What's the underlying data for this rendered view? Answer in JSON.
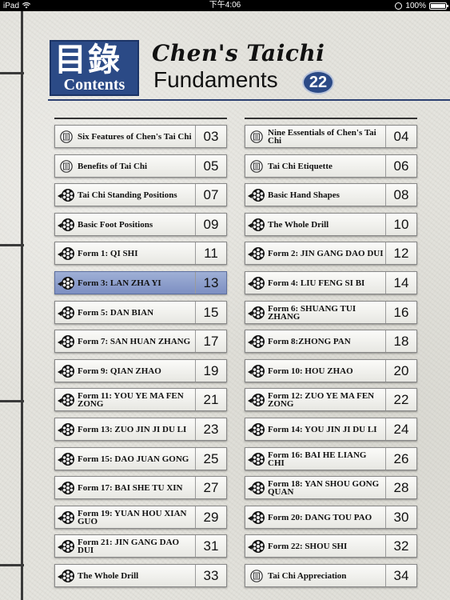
{
  "status_bar": {
    "device": "iPad",
    "time": "下午4:06",
    "battery": "100%"
  },
  "header": {
    "logo_chars": "目錄",
    "logo_en": "Contents",
    "title_line1": "Chen's Taichi",
    "title_line2": "Fundaments",
    "badge": "22"
  },
  "colors": {
    "accent": "#2b4a86",
    "selected": "#8a9bcb"
  },
  "left_items": [
    {
      "label": "Six Features of Chen's Tai Chi",
      "page": "03",
      "icon": "document-icon"
    },
    {
      "label": "Benefits of Tai Chi",
      "page": "05",
      "icon": "document-icon"
    },
    {
      "label": "Tai Chi Standing Positions",
      "page": "07",
      "icon": "film-reel-icon"
    },
    {
      "label": "Basic Foot Positions",
      "page": "09",
      "icon": "film-reel-icon"
    },
    {
      "label": "Form 1: QI SHI",
      "page": "11",
      "icon": "film-reel-icon"
    },
    {
      "label": "Form 3: LAN ZHA YI",
      "page": "13",
      "icon": "film-reel-icon",
      "selected": true
    },
    {
      "label": "Form 5: DAN BIAN",
      "page": "15",
      "icon": "film-reel-icon"
    },
    {
      "label": "Form 7: SAN HUAN ZHANG",
      "page": "17",
      "icon": "film-reel-icon"
    },
    {
      "label": "Form 9: QIAN ZHAO",
      "page": "19",
      "icon": "film-reel-icon"
    },
    {
      "label": "Form 11: YOU YE MA FEN ZONG",
      "page": "21",
      "icon": "film-reel-icon"
    },
    {
      "label": "Form 13: ZUO JIN JI DU LI",
      "page": "23",
      "icon": "film-reel-icon"
    },
    {
      "label": "Form 15: DAO JUAN GONG",
      "page": "25",
      "icon": "film-reel-icon"
    },
    {
      "label": "Form 17: BAI SHE TU XIN",
      "page": "27",
      "icon": "film-reel-icon"
    },
    {
      "label": "Form 19: YUAN HOU XIAN GUO",
      "page": "29",
      "icon": "film-reel-icon"
    },
    {
      "label": "Form 21: JIN GANG DAO DUI",
      "page": "31",
      "icon": "film-reel-icon"
    },
    {
      "label": "The Whole Drill",
      "page": "33",
      "icon": "film-reel-icon"
    }
  ],
  "right_items": [
    {
      "label": "Nine Essentials of Chen's Tai Chi",
      "page": "04",
      "icon": "document-icon"
    },
    {
      "label": "Tai Chi Etiquette",
      "page": "06",
      "icon": "document-icon"
    },
    {
      "label": "Basic Hand Shapes",
      "page": "08",
      "icon": "film-reel-icon"
    },
    {
      "label": "The Whole Drill",
      "page": "10",
      "icon": "film-reel-icon"
    },
    {
      "label": "Form 2: JIN GANG DAO DUI",
      "page": "12",
      "icon": "film-reel-icon"
    },
    {
      "label": "Form 4:  LIU FENG SI BI",
      "page": "14",
      "icon": "film-reel-icon"
    },
    {
      "label": "Form 6: SHUANG TUI ZHANG",
      "page": "16",
      "icon": "film-reel-icon"
    },
    {
      "label": "Form 8:ZHONG PAN",
      "page": "18",
      "icon": "film-reel-icon"
    },
    {
      "label": "Form 10: HOU ZHAO",
      "page": "20",
      "icon": "film-reel-icon"
    },
    {
      "label": "Form 12: ZUO YE MA FEN ZONG",
      "page": "22",
      "icon": "film-reel-icon"
    },
    {
      "label": "Form 14: YOU JIN JI DU LI",
      "page": "24",
      "icon": "film-reel-icon"
    },
    {
      "label": "Form 16: BAI HE LIANG CHI",
      "page": "26",
      "icon": "film-reel-icon"
    },
    {
      "label": "Form 18: YAN SHOU GONG QUAN",
      "page": "28",
      "icon": "film-reel-icon"
    },
    {
      "label": "Form 20:  DANG TOU PAO",
      "page": "30",
      "icon": "film-reel-icon"
    },
    {
      "label": "Form 22: SHOU SHI",
      "page": "32",
      "icon": "film-reel-icon"
    },
    {
      "label": "Tai Chi Appreciation",
      "page": "34",
      "icon": "document-icon"
    }
  ]
}
